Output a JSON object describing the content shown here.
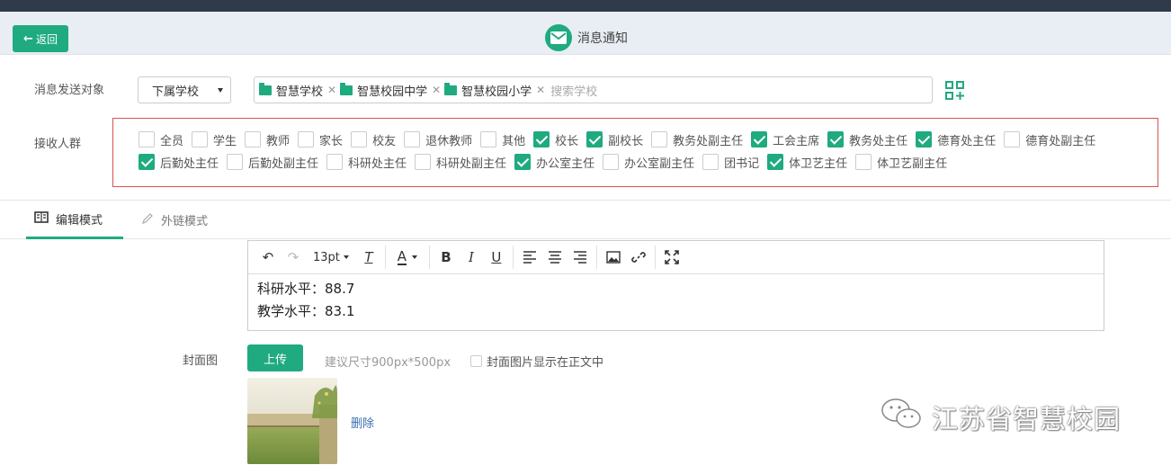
{
  "header": {
    "back_label": "返回",
    "title": "消息通知",
    "icon": "envelope-icon"
  },
  "target": {
    "label": "消息发送对象",
    "select_value": "下属学校",
    "tags": [
      "智慧学校",
      "智慧校园中学",
      "智慧校园小学"
    ],
    "search_placeholder": "搜索学校"
  },
  "receivers": {
    "label": "接收人群",
    "row1": [
      {
        "label": "全员",
        "checked": false
      },
      {
        "label": "学生",
        "checked": false
      },
      {
        "label": "教师",
        "checked": false
      },
      {
        "label": "家长",
        "checked": false
      },
      {
        "label": "校友",
        "checked": false
      },
      {
        "label": "退休教师",
        "checked": false
      },
      {
        "label": "其他",
        "checked": false
      },
      {
        "label": "校长",
        "checked": true
      },
      {
        "label": "副校长",
        "checked": true
      },
      {
        "label": "教务处副主任",
        "checked": false
      },
      {
        "label": "工会主席",
        "checked": true
      },
      {
        "label": "教务处主任",
        "checked": true
      },
      {
        "label": "德育处主任",
        "checked": true
      },
      {
        "label": "德育处副主任",
        "checked": false
      }
    ],
    "row2": [
      {
        "label": "后勤处主任",
        "checked": true
      },
      {
        "label": "后勤处副主任",
        "checked": false
      },
      {
        "label": "科研处主任",
        "checked": false
      },
      {
        "label": "科研处副主任",
        "checked": false
      },
      {
        "label": "办公室主任",
        "checked": true
      },
      {
        "label": "办公室副主任",
        "checked": false
      },
      {
        "label": "团书记",
        "checked": false
      },
      {
        "label": "体卫艺主任",
        "checked": true
      },
      {
        "label": "体卫艺副主任",
        "checked": false
      }
    ]
  },
  "tabs": {
    "edit_mode": "编辑模式",
    "link_mode": "外链模式"
  },
  "editor": {
    "font_size": "13pt",
    "lines": [
      "科研水平：88.7",
      "教学水平：83.1"
    ]
  },
  "cover": {
    "label": "封面图",
    "upload_label": "上传",
    "hint": "建议尺寸900px*500px",
    "show_in_body_label": "封面图片显示在正文中",
    "delete_label": "删除"
  },
  "watermark": "江苏省智慧校园",
  "colors": {
    "accent": "#1faa80",
    "topbar": "#2f3b4a",
    "header_bg": "#e8eef4",
    "highlight_border": "#d9534f"
  }
}
